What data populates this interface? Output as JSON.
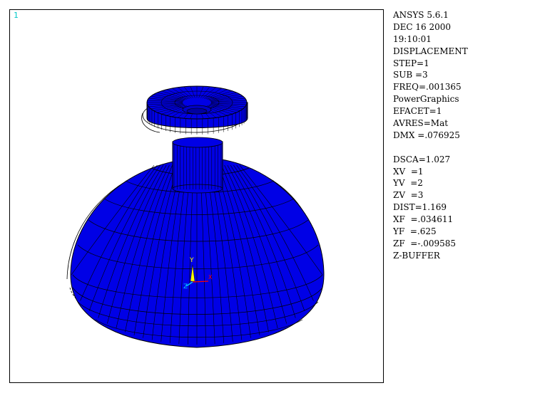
{
  "window": {
    "number": "1"
  },
  "model": {
    "fill_color": "#0000e6",
    "mesh_color": "#000000",
    "undeformed_outline_color": "#000000",
    "triad_labels": {
      "y": "Y",
      "z": "Z",
      "x": "X"
    },
    "triad_colors": {
      "y": "#ffff00",
      "z": "#00c8ff",
      "x": "#ff0000"
    }
  },
  "info": {
    "group1": [
      "ANSYS 5.6.1",
      "DEC 16 2000",
      "19:10:01",
      "DISPLACEMENT",
      "STEP=1",
      "SUB =3",
      "FREQ=.001365",
      "PowerGraphics",
      "EFACET=1",
      "AVRES=Mat",
      "DMX =.076925"
    ],
    "group2": [
      "DSCA=1.027",
      "XV  =1",
      "YV  =2",
      "ZV  =3",
      "DIST=1.169",
      "XF  =.034611",
      "YF  =.625",
      "ZF  =-.009585",
      "Z-BUFFER"
    ]
  }
}
